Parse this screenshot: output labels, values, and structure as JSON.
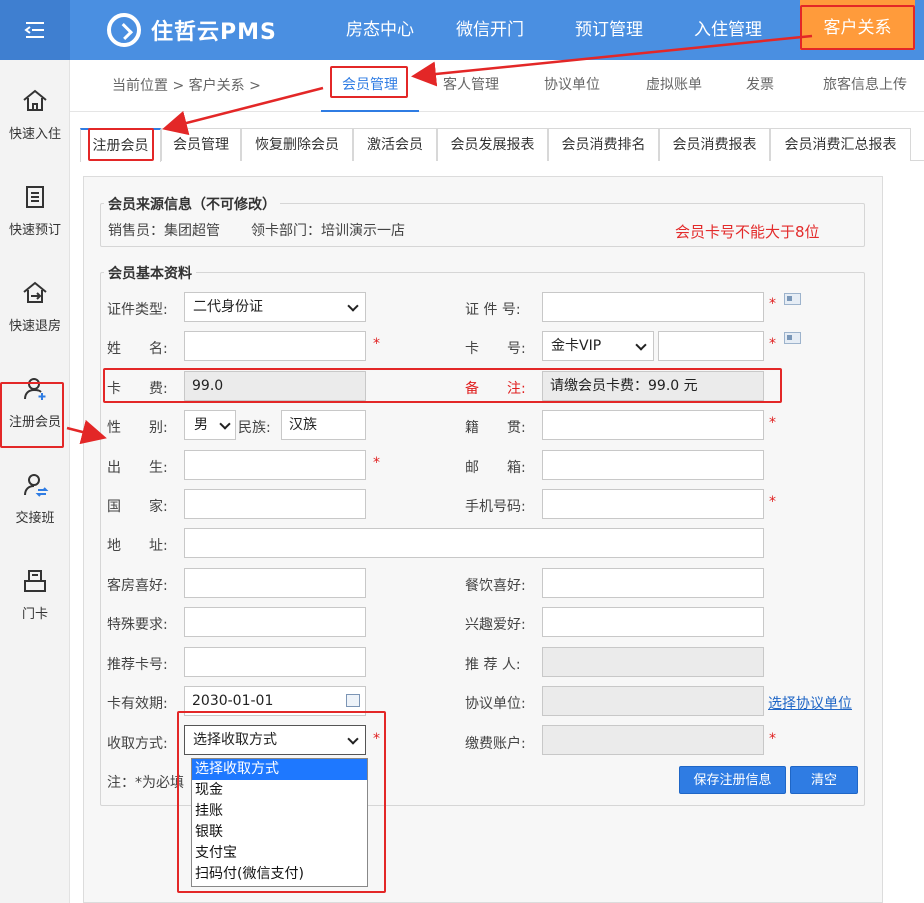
{
  "app": {
    "title": "住哲云PMS"
  },
  "topnav": [
    {
      "label": "房态中心"
    },
    {
      "label": "微信开门"
    },
    {
      "label": "预订管理"
    },
    {
      "label": "入住管理"
    },
    {
      "label": "客户关系"
    }
  ],
  "sidebar": [
    {
      "label": "快速入住",
      "icon": "home-icon"
    },
    {
      "label": "快速预订",
      "icon": "doc-icon"
    },
    {
      "label": "快速退房",
      "icon": "checkout-icon"
    },
    {
      "label": "注册会员",
      "icon": "user-add-icon"
    },
    {
      "label": "交接班",
      "icon": "user-swap-icon"
    },
    {
      "label": "门卡",
      "icon": "card-icon"
    }
  ],
  "breadcrumb": "当前位置 > 客户关系 >",
  "subnav": [
    {
      "label": "会员管理"
    },
    {
      "label": "客人管理"
    },
    {
      "label": "协议单位"
    },
    {
      "label": "虚拟账单"
    },
    {
      "label": "发票"
    },
    {
      "label": "旅客信息上传"
    }
  ],
  "tabs": [
    {
      "label": "注册会员"
    },
    {
      "label": "会员管理"
    },
    {
      "label": "恢复删除会员"
    },
    {
      "label": "激活会员"
    },
    {
      "label": "会员发展报表"
    },
    {
      "label": "会员消费排名"
    },
    {
      "label": "会员消费报表"
    },
    {
      "label": "会员消费汇总报表"
    }
  ],
  "source": {
    "legend": "会员来源信息（不可修改）",
    "salesperson": "销售员：集团超管",
    "dept": "领卡部门：培训演示一店"
  },
  "warning": "会员卡号不能大于8位",
  "basic": {
    "legend": "会员基本资料",
    "id_type_label": "证件类型:",
    "id_type_value": "二代身份证",
    "id_no_label": "证 件 号:",
    "name_label": "姓　　名:",
    "card_no_label": "卡　　号:",
    "card_type_value": "金卡VIP",
    "fee_label": "卡　　费:",
    "fee_value": "99.0",
    "remark_label": "备　　注:",
    "remark_value": "请缴会员卡费：99.0 元",
    "gender_label": "性　　别:",
    "gender_value": "男",
    "ethnic_label": "民族:",
    "ethnic_value": "汉族",
    "native_label": "籍　　贯:",
    "birth_label": "出　　生:",
    "email_label": "邮　　箱:",
    "country_label": "国　　家:",
    "mobile_label": "手机号码:",
    "address_label": "地　　址:",
    "room_pref_label": "客房喜好:",
    "food_pref_label": "餐饮喜好:",
    "special_label": "特殊要求:",
    "hobby_label": "兴趣爱好:",
    "ref_card_label": "推荐卡号:",
    "referrer_label": "推 荐 人:",
    "expiry_label": "卡有效期:",
    "expiry_value": "2030-01-01",
    "agreement_label": "协议单位:",
    "agreement_link": "选择协议单位",
    "payment_label": "收取方式:",
    "payment_value": "选择收取方式",
    "pay_account_label": "缴费账户:",
    "note": "注：*为必填",
    "required_mark": "*"
  },
  "buttons": {
    "save": "保存注册信息",
    "clear": "清空"
  },
  "payment_options": [
    "选择收取方式",
    "现金",
    "挂账",
    "银联",
    "支付宝",
    "扫码付(微信支付)"
  ],
  "colors": {
    "topbar": "#4a8fe1",
    "accent": "#2f7ce3",
    "active_top": "#ff9b3b",
    "annotation": "#e32727"
  }
}
